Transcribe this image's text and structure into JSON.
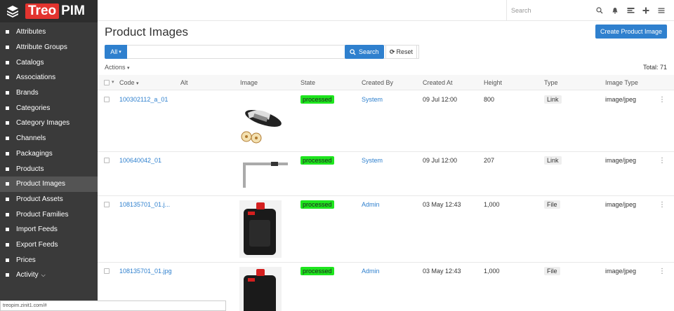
{
  "app": {
    "logo_treo": "Treo",
    "logo_pim": "PIM"
  },
  "sidebar": {
    "items": [
      {
        "label": "Attributes"
      },
      {
        "label": "Attribute Groups"
      },
      {
        "label": "Catalogs"
      },
      {
        "label": "Associations"
      },
      {
        "label": "Brands"
      },
      {
        "label": "Categories"
      },
      {
        "label": "Category Images"
      },
      {
        "label": "Channels"
      },
      {
        "label": "Packagings"
      },
      {
        "label": "Products"
      },
      {
        "label": "Product Images",
        "active": true
      },
      {
        "label": "Product Assets"
      },
      {
        "label": "Product Families"
      },
      {
        "label": "Import Feeds"
      },
      {
        "label": "Export Feeds"
      },
      {
        "label": "Prices"
      },
      {
        "label": "Activity"
      }
    ]
  },
  "topbar": {
    "search_placeholder": "Search",
    "icons": [
      "search-icon",
      "bell-icon",
      "notes-icon",
      "plus-icon",
      "menu-icon"
    ]
  },
  "main": {
    "title": "Product Images",
    "create_label": "Create Product Image",
    "filter_all_label": "All",
    "search_label": "Search",
    "reset_label": "Reset",
    "actions_label": "Actions",
    "total_label": "Total: 71"
  },
  "table": {
    "headers": {
      "code": "Code",
      "alt": "Alt",
      "image": "Image",
      "state": "State",
      "created_by": "Created By",
      "created_at": "Created At",
      "height": "Height",
      "type": "Type",
      "image_type": "Image Type"
    },
    "rows": [
      {
        "code": "100302112_a_01",
        "alt": "",
        "state": "processed",
        "created_by": "System",
        "created_at": "09 Jul 12:00",
        "height": "800",
        "type": "Link",
        "image_type": "image/jpeg"
      },
      {
        "code": "100640042_01",
        "alt": "",
        "state": "processed",
        "created_by": "System",
        "created_at": "09 Jul 12:00",
        "height": "207",
        "type": "Link",
        "image_type": "image/jpeg"
      },
      {
        "code": "108135701_01.j...",
        "alt": "",
        "state": "processed",
        "created_by": "Admin",
        "created_at": "03 May 12:43",
        "height": "1,000",
        "type": "File",
        "image_type": "image/jpeg"
      },
      {
        "code": "108135701_01.jpg",
        "alt": "",
        "state": "processed",
        "created_by": "Admin",
        "created_at": "03 May 12:43",
        "height": "1,000",
        "type": "File",
        "image_type": "image/jpeg"
      }
    ]
  },
  "status_bar": {
    "url": "treopim.zinit1.com/#"
  },
  "colors": {
    "accent": "#2f80ce",
    "state_green": "#1ee51e",
    "sidebar_bg": "#3a3a3a",
    "logo_red": "#e3342f"
  }
}
